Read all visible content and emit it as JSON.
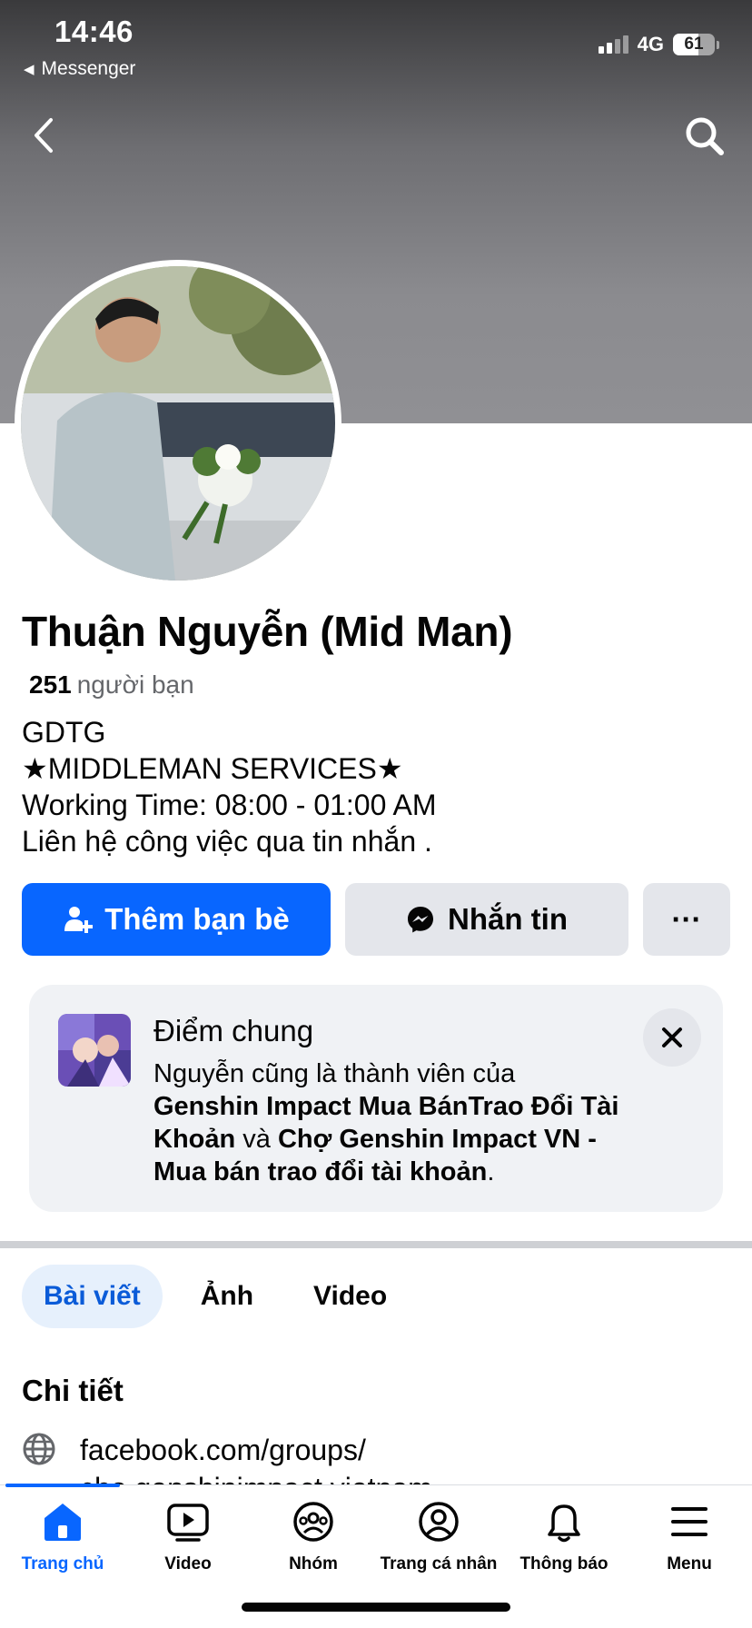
{
  "status_bar": {
    "time": "14:46",
    "back_app": "Messenger",
    "network": "4G",
    "battery_level": "61",
    "battery_fraction": 0.61
  },
  "nav": {
    "back_icon": "chevron-left-icon",
    "search_icon": "search-icon"
  },
  "profile": {
    "name": "Thuận Nguyễn (Mid Man)",
    "friends_count": "251",
    "friends_label": "người bạn",
    "bio": [
      "GDTG",
      "★MIDDLEMAN SERVICES★",
      "Working Time: 08:00 - 01:00 AM",
      "Liên hệ công việc qua tin nhắn ."
    ]
  },
  "actions": {
    "add_friend_label": "Thêm bạn bè",
    "message_label": "Nhắn tin",
    "more_label": "···"
  },
  "mutual_card": {
    "title": "Điểm chung",
    "intro": "Nguyễn cũng là thành viên của",
    "group_1": "Genshin Impact Mua BánTrao Đổi Tài Khoản",
    "connector": "và",
    "group_2": "Chợ Genshin Impact VN - Mua bán trao đổi tài khoản",
    "end": "."
  },
  "tabs": [
    {
      "label": "Bài viết",
      "active": true
    },
    {
      "label": "Ảnh",
      "active": false
    },
    {
      "label": "Video",
      "active": false
    }
  ],
  "details": {
    "title": "Chi tiết",
    "link_line_1": "facebook.com/groups/",
    "link_line_2": "cho.genshinimpact.vietnam"
  },
  "bottom_nav": [
    {
      "label": "Trang chủ",
      "icon": "home-icon",
      "active": true
    },
    {
      "label": "Video",
      "icon": "video-icon",
      "active": false
    },
    {
      "label": "Nhóm",
      "icon": "groups-icon",
      "active": false
    },
    {
      "label": "Trang cá nhân",
      "icon": "profile-icon",
      "active": false
    },
    {
      "label": "Thông báo",
      "icon": "bell-icon",
      "active": false
    },
    {
      "label": "Menu",
      "icon": "menu-icon",
      "active": false
    }
  ],
  "colors": {
    "accent": "#0866ff",
    "secondary_button": "#e4e6eb",
    "card_bg": "#f0f2f5",
    "muted_text": "#65676b"
  }
}
